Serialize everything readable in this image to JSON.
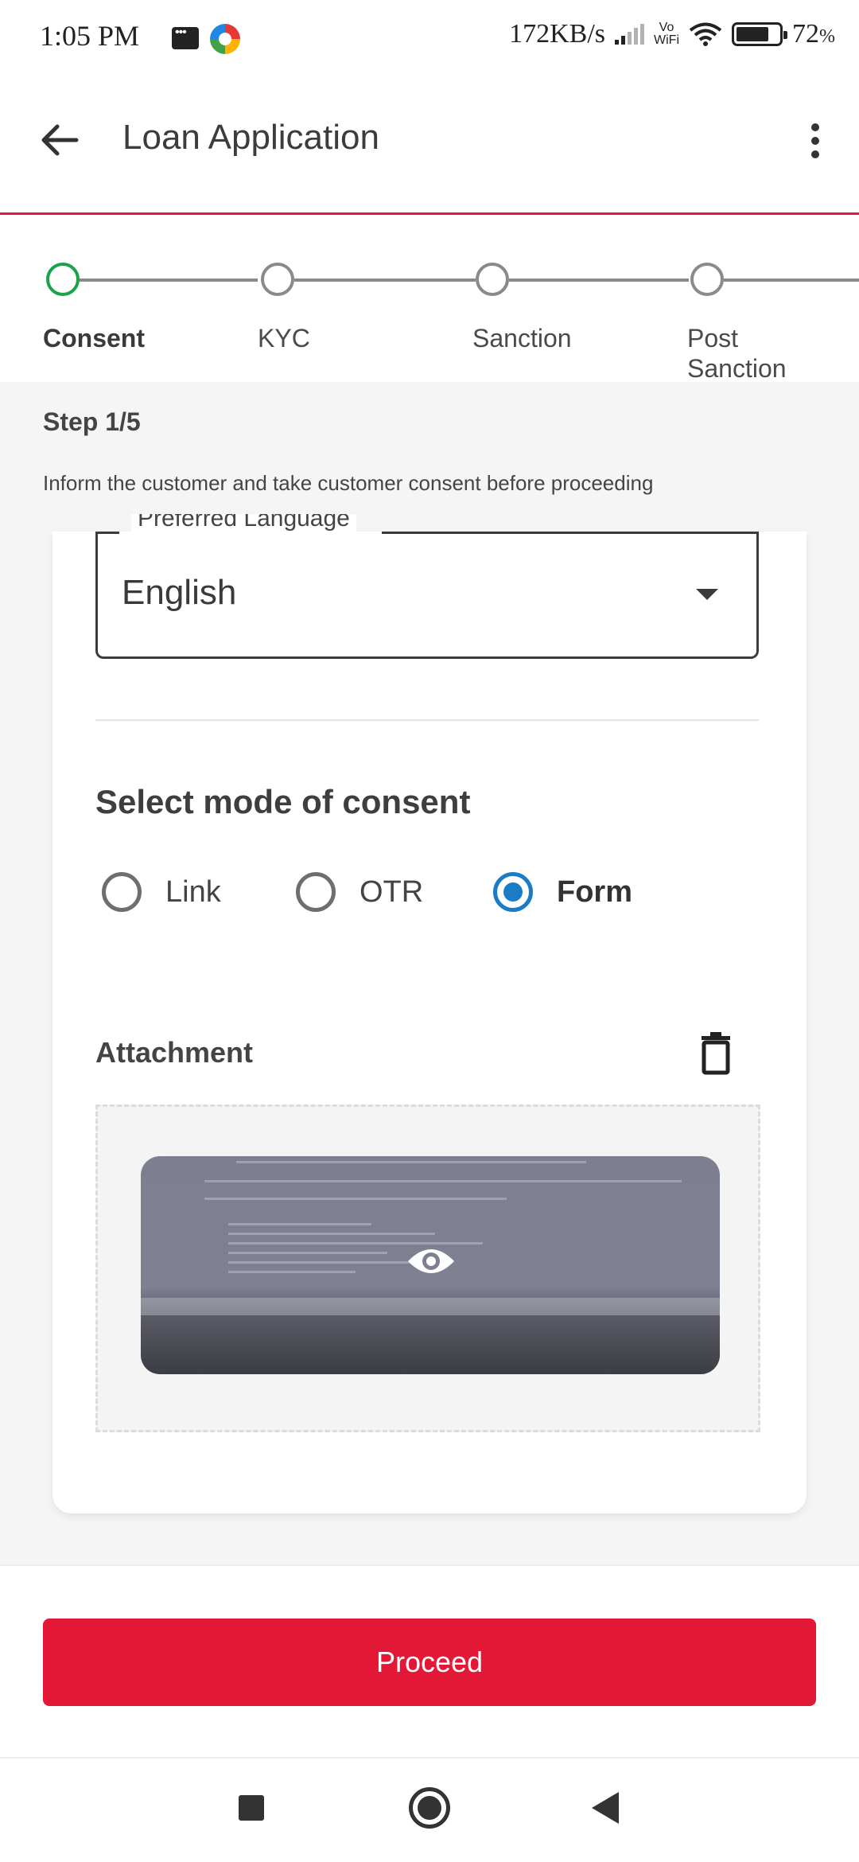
{
  "status_bar": {
    "time": "1:05 PM",
    "network_speed": "172KB/s",
    "vowifi_top": "Vo",
    "vowifi_bottom": "WiFi",
    "battery": "72",
    "battery_unit": "%"
  },
  "app_bar": {
    "title": "Loan Application",
    "back_icon": "arrow-left-icon",
    "menu_icon": "more-vertical-icon"
  },
  "stepper": {
    "steps": [
      {
        "label": "Consent",
        "active": true
      },
      {
        "label": "KYC",
        "active": false
      },
      {
        "label": "Sanction",
        "active": false
      },
      {
        "label": "Post\nSanction",
        "active": false
      }
    ],
    "active_color": "#1aa34a",
    "inactive_color": "#8a8a8a"
  },
  "info": {
    "step_count": "Step 1/5",
    "description": "Inform the customer and take customer consent before proceeding"
  },
  "form": {
    "language_label": "Preferred Language",
    "language_value": "English",
    "consent_title": "Select mode of consent",
    "consent_options": [
      {
        "label": "Link",
        "selected": false
      },
      {
        "label": "OTR",
        "selected": false
      },
      {
        "label": "Form",
        "selected": true
      }
    ],
    "attachment_title": "Attachment",
    "delete_icon": "trash-icon",
    "preview_icon": "eye-icon"
  },
  "actions": {
    "proceed_label": "Proceed",
    "primary_color": "#e31837"
  },
  "nav": {
    "recents_icon": "square-icon",
    "home_icon": "circle-icon",
    "back_icon": "triangle-back-icon"
  },
  "colors": {
    "accent_red": "#e31837",
    "radio_selected": "#1a7cc7"
  }
}
